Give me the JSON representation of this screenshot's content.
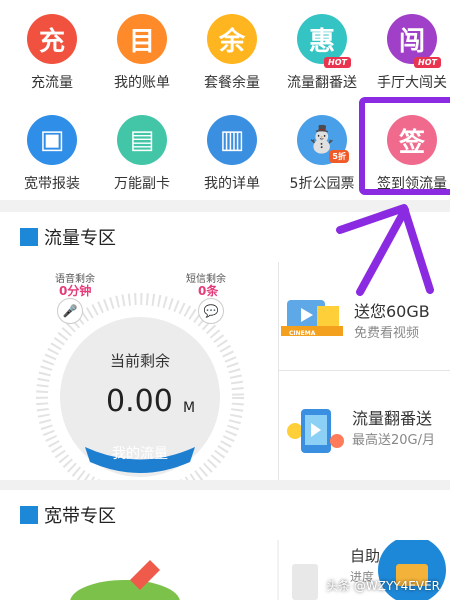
{
  "grid": {
    "row1": [
      {
        "icon_text": "充",
        "label": "充流量",
        "color": "#f0523f"
      },
      {
        "icon_text": "目",
        "label": "我的账单",
        "color": "#ff8a2a"
      },
      {
        "icon_text": "余",
        "label": "套餐余量",
        "color": "#ffb51f"
      },
      {
        "icon_text": "惠",
        "label": "流量翻番送",
        "color": "#35c4c4",
        "badge": "HOT"
      },
      {
        "icon_text": "闯",
        "label": "手厅大闯关",
        "color": "#a040c8",
        "badge": "HOT"
      }
    ],
    "row2": [
      {
        "icon_text": "▣",
        "label": "宽带报装",
        "color": "#2f8ee8"
      },
      {
        "icon_text": "▤",
        "label": "万能副卡",
        "color": "#43c6a8"
      },
      {
        "icon_text": "▥",
        "label": "我的详单",
        "color": "#3b8fe0"
      },
      {
        "icon_text": "⛄",
        "label": "5折公园票",
        "color": "#4aa0e8",
        "badge": "5折"
      },
      {
        "icon_text": "签",
        "label": "签到领流量",
        "color": "#ef6a8c"
      }
    ]
  },
  "traffic_section": {
    "title": "流量专区",
    "voice_label": "语音剩余",
    "voice_value": "0分钟",
    "sms_label": "短信剩余",
    "sms_value": "0条",
    "center_label": "当前剩余",
    "center_value": "0.00",
    "center_unit": "M",
    "my_traffic_button": "我的流量",
    "promo1_title": "送您60GB",
    "promo1_sub": "免费看视频",
    "promo1_badge": "CINEMA",
    "promo2_title": "流量翻番送",
    "promo2_sub": "最高送20G/月"
  },
  "broadband_section": {
    "title": "宽带专区",
    "promo_title": "自助",
    "promo_sub": "进度"
  },
  "watermark": "头条 @WZYY4EVER",
  "colors": {
    "accent_blue": "#1e88d8",
    "annotation_purple": "#8a2be2",
    "pink_value": "#e63b7a"
  }
}
